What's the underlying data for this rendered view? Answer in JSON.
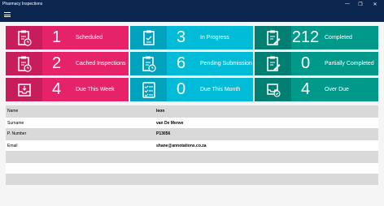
{
  "window": {
    "title": "Pharmacy Inspections",
    "controls": [
      "—",
      "❐",
      "✕"
    ]
  },
  "tiles": [
    {
      "number": "1",
      "label": "Scheduled",
      "icon": "clipboard-clock-icon",
      "color": "pink"
    },
    {
      "number": "3",
      "label": "In Progress",
      "icon": "clipboard-check-icon",
      "color": "cyan"
    },
    {
      "number": "212",
      "label": "Completed",
      "icon": "clipboard-pen-icon",
      "color": "teal"
    },
    {
      "number": "2",
      "label": "Cached Inspections",
      "icon": "clipboard-clock-icon",
      "color": "pink"
    },
    {
      "number": "6",
      "label": "Pending Submission",
      "icon": "clipboard-clock-icon",
      "color": "cyan"
    },
    {
      "number": "0",
      "label": "Partially Completed",
      "icon": "clipboard-pen-icon",
      "color": "teal"
    },
    {
      "number": "4",
      "label": "Due This Week",
      "icon": "inbox-tray-icon",
      "color": "pink"
    },
    {
      "number": "0",
      "label": "Due This Month",
      "icon": "checklist-icon",
      "color": "cyan"
    },
    {
      "number": "4",
      "label": "Over Due",
      "icon": "inbox-check-icon",
      "color": "teal"
    }
  ],
  "user_details": [
    {
      "key": "Name",
      "value": "Ieon"
    },
    {
      "key": "Surname",
      "value": "van De Merwe"
    },
    {
      "key": "P. Number",
      "value": "P13056"
    },
    {
      "key": "Email",
      "value": "shane@annotations.co.za"
    }
  ]
}
